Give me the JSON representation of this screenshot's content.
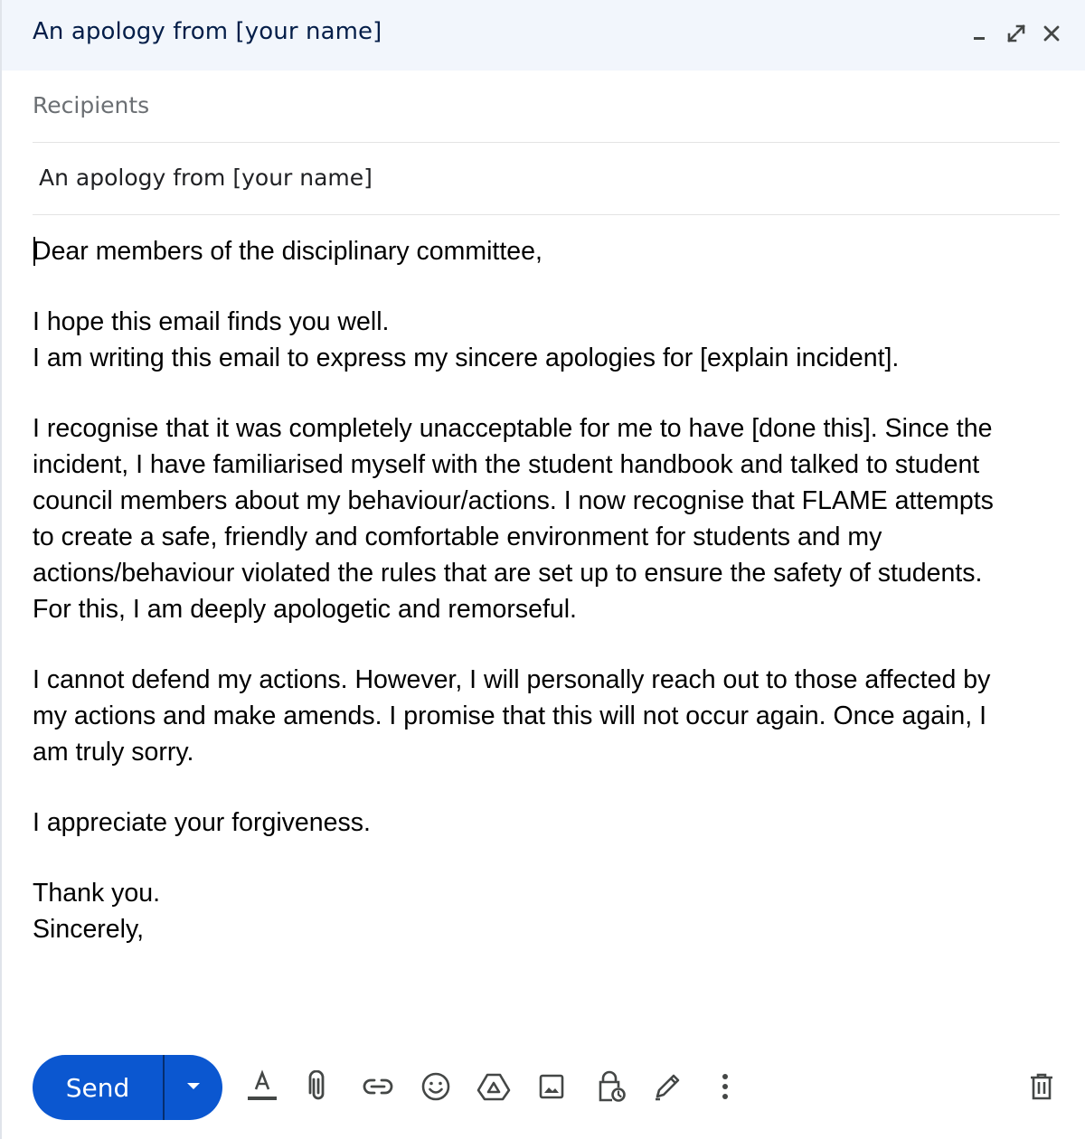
{
  "window": {
    "title": "An apology from [your name]"
  },
  "header": {
    "recipients_label": "Recipients",
    "subject": "An apology from [your name]"
  },
  "body": {
    "greeting": "Dear members of the disciplinary committee,",
    "p1_line1": "I hope this email finds you well.",
    "p1_line2": "I am writing this email to express my sincere apologies for [explain incident].",
    "p2_line1": "I recognise that it was completely unacceptable for me to have [done this]. Since the",
    "p2_line2": "incident, I have familiarised myself with the student handbook and talked to student",
    "p2_line3": "council members about my behaviour/actions. I now recognise that FLAME attempts",
    "p2_line4": "to create a safe, friendly and comfortable environment for students and my",
    "p2_line5": "actions/behaviour violated the rules that are set up to ensure the safety of students.",
    "p2_line6": "For this, I am deeply apologetic and remorseful.",
    "p3_line1": "I cannot defend my actions. However, I will personally reach out to those affected by",
    "p3_line2": "my actions and make amends. I promise that this will not occur again. Once again, I",
    "p3_line3": "am truly sorry.",
    "p4": "I appreciate your forgiveness.",
    "closing1": "Thank you.",
    "closing2": "Sincerely,"
  },
  "toolbar": {
    "send_label": "Send",
    "icons": [
      "formatting-icon",
      "attach-icon",
      "link-icon",
      "emoji-icon",
      "drive-icon",
      "photo-icon",
      "confidential-icon",
      "signature-icon",
      "more-options-icon",
      "discard-icon"
    ]
  },
  "colors": {
    "accent": "#0b57d0",
    "title_bar": "#f2f6fc",
    "title_text": "#041e49",
    "icon": "#444746"
  }
}
